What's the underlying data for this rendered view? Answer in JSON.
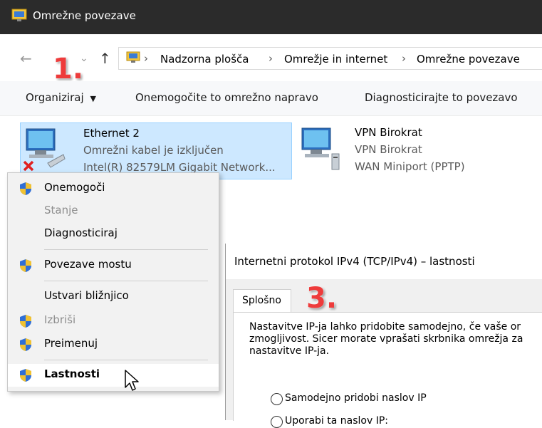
{
  "window": {
    "title": "Omrežne povezave"
  },
  "address": {
    "crumbs": [
      "Nadzorna plošča",
      "Omrežje in internet",
      "Omrežne povezave"
    ]
  },
  "badges": {
    "step1": "1.",
    "step3": "3."
  },
  "commands": {
    "organize": "Organiziraj",
    "disable_device": "Onemogočite to omrežno napravo",
    "diagnose": "Diagnosticirajte to povezavo"
  },
  "connections": [
    {
      "name": "Ethernet 2",
      "status": "Omrežni kabel je izključen",
      "device": "Intel(R) 82579LM Gigabit Network..."
    },
    {
      "name": "VPN Birokrat",
      "status": "VPN Birokrat",
      "device": "WAN Miniport (PPTP)"
    }
  ],
  "context_menu": {
    "items": [
      {
        "label": "Onemogoči",
        "shield": true,
        "enabled": true
      },
      {
        "label": "Stanje",
        "shield": false,
        "enabled": false
      },
      {
        "label": "Diagnosticiraj",
        "shield": false,
        "enabled": true
      },
      {
        "label": "Povezave mostu",
        "shield": true,
        "enabled": true
      },
      {
        "label": "Ustvari bližnjico",
        "shield": false,
        "enabled": true
      },
      {
        "label": "Izbriši",
        "shield": true,
        "enabled": false
      },
      {
        "label": "Preimenuj",
        "shield": true,
        "enabled": true
      },
      {
        "label": "Lastnosti",
        "shield": true,
        "enabled": true,
        "bold": true,
        "hovered": true
      }
    ]
  },
  "dialog": {
    "title": "Internetni protokol IPv4 (TCP/IPv4) – lastnosti",
    "tab": "Splošno",
    "description_lines": [
      "Nastavitve IP-ja lahko pridobite samodejno, če vaše or",
      "zmogljivost. Sicer morate vprašati skrbnika omrežja za",
      "nastavitve IP-ja."
    ],
    "radio_auto_ip": "Samodejno pridobi naslov IP",
    "radio_manual_ip": "Uporabi ta naslov IP:"
  },
  "colors": {
    "titlebar": "#2b2b2b",
    "selection": "#cde8ff",
    "badge": "#ee3b3b",
    "disabled_text": "#8e8e8e"
  }
}
